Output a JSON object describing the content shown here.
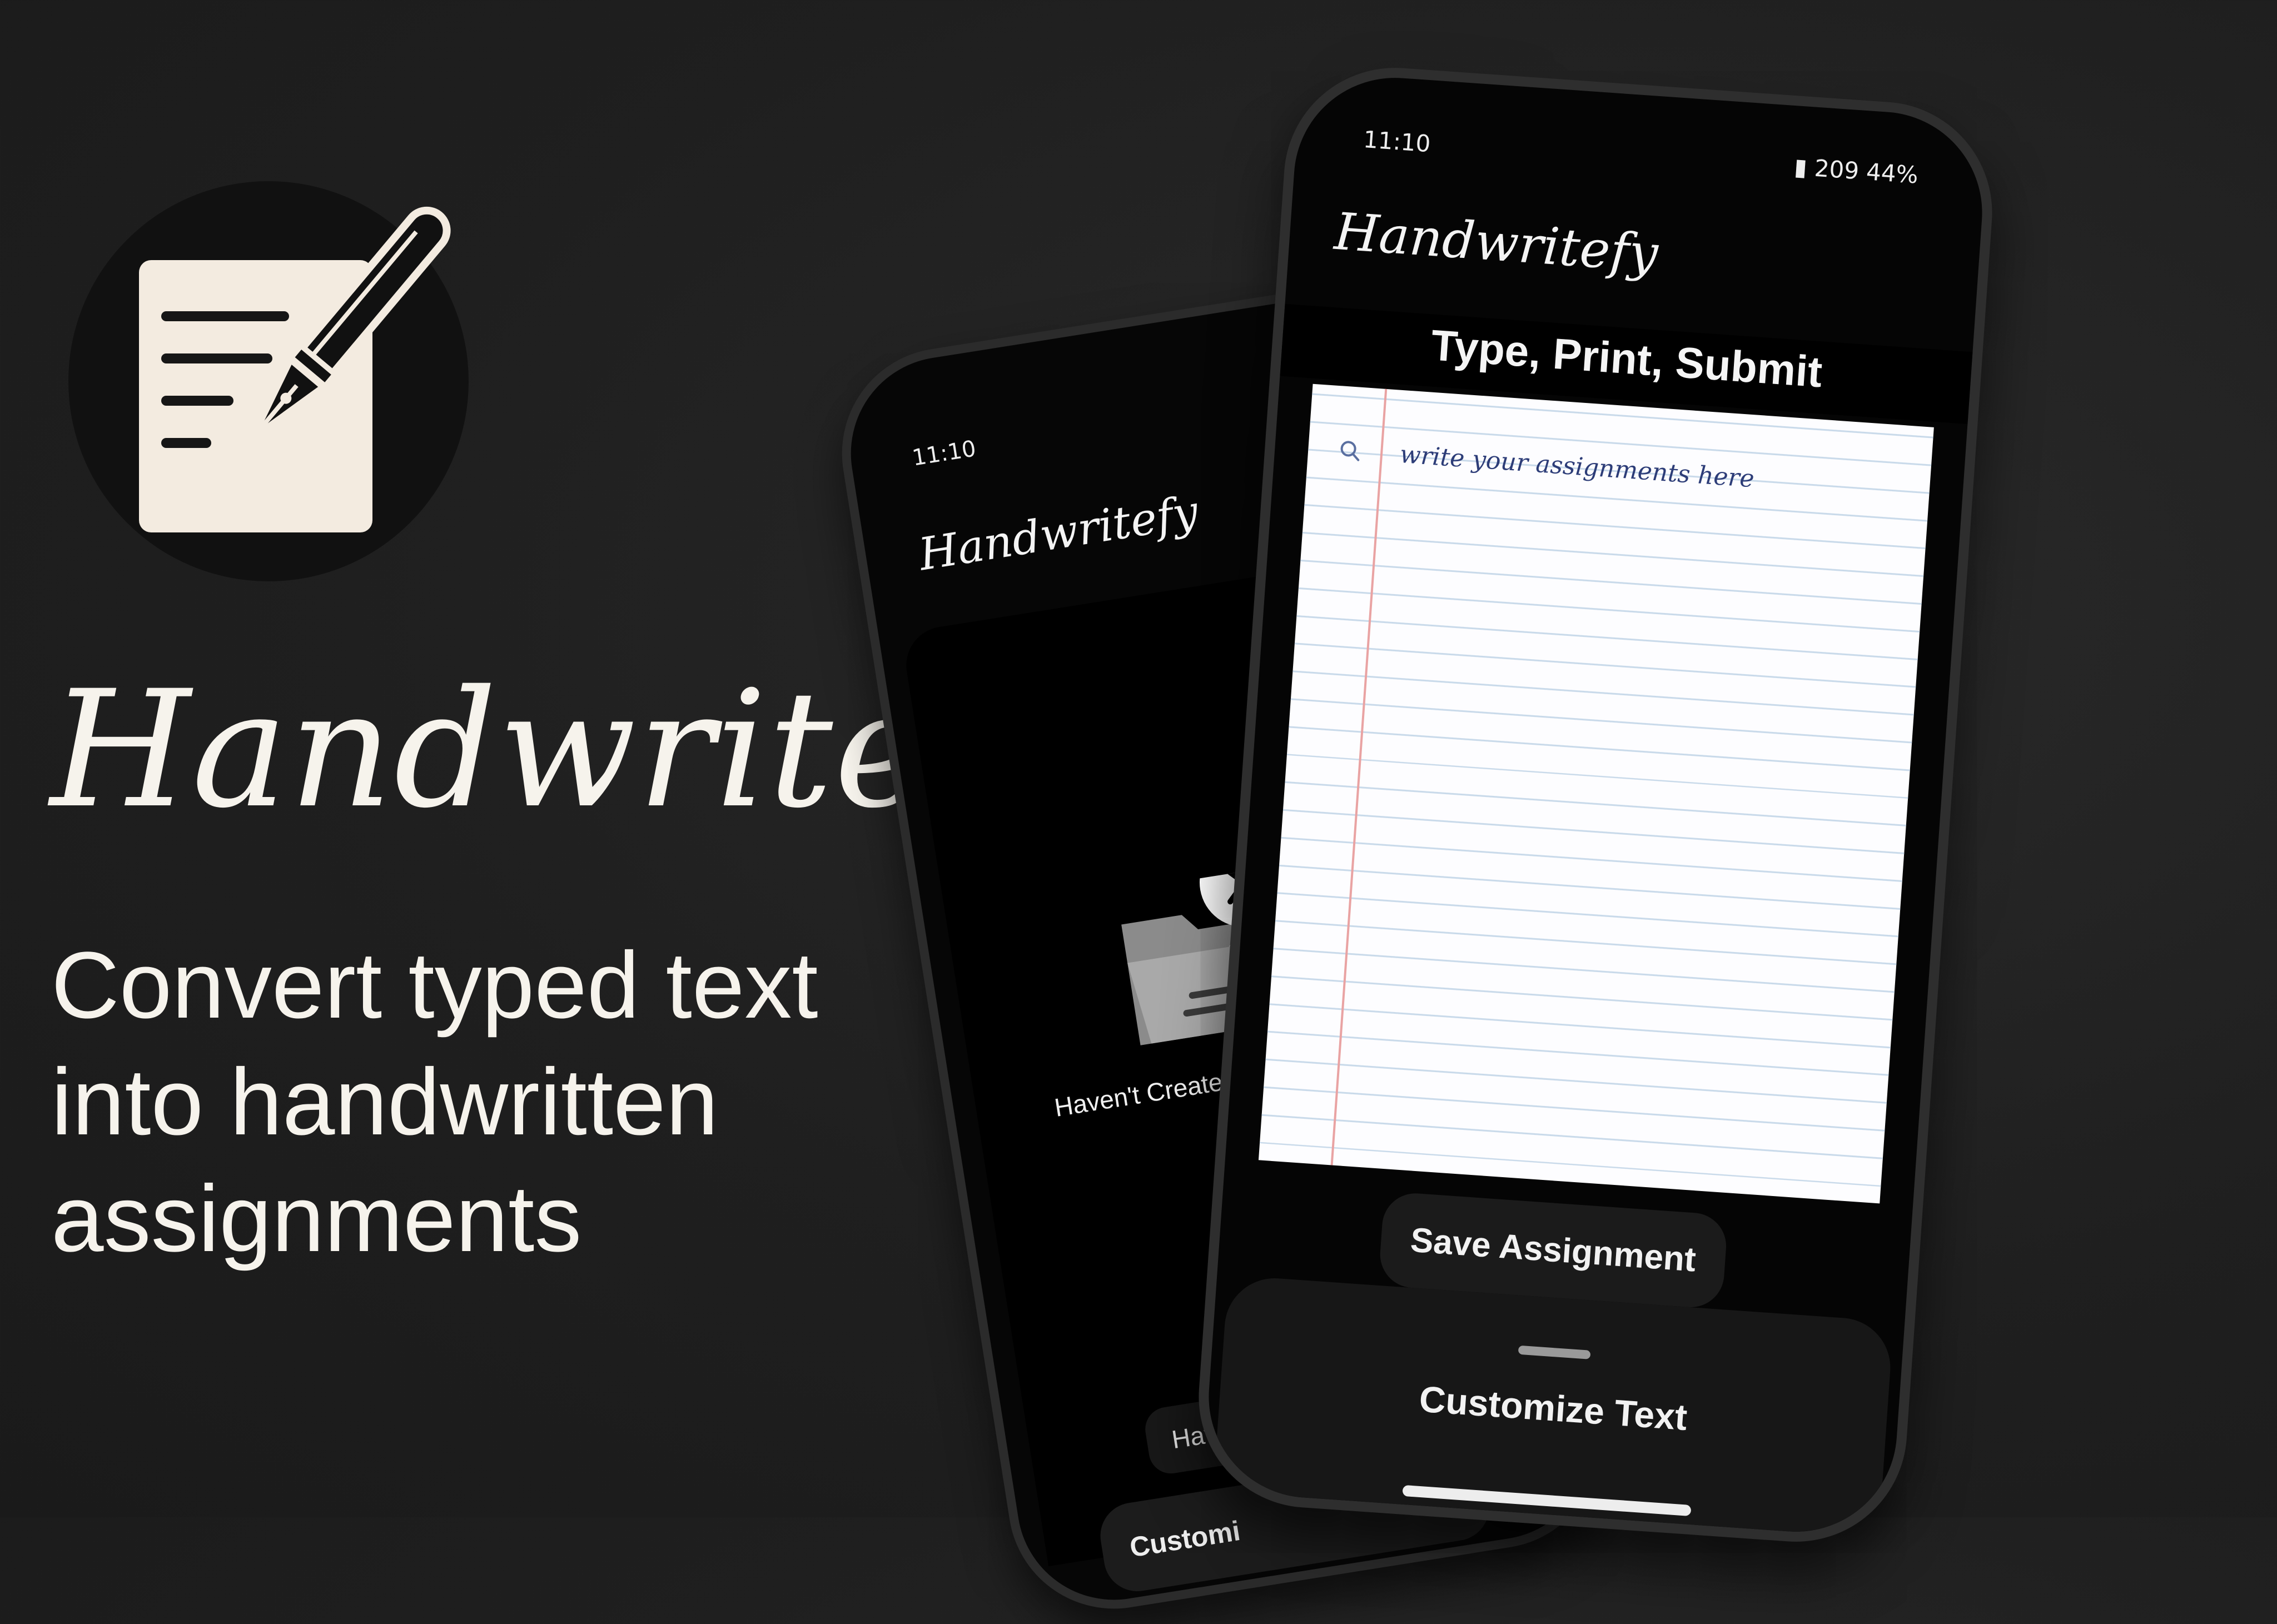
{
  "brand": {
    "app_name": "Handwritefy",
    "tagline": "Convert typed text into handwritten assignments"
  },
  "back_phone": {
    "status_time": "11:10",
    "app_title": "Handwritefy",
    "empty_state_label": "Haven't Created A",
    "button_partial_1": "Have",
    "button_partial_2": "Customi"
  },
  "front_phone": {
    "status_time": "11:10",
    "status_right": "209 44%",
    "app_title": "Handwritefy",
    "header": "Type, Print, Submit",
    "editor_placeholder": "write your assignments here",
    "save_button": "Save Assignment",
    "customize_button": "Customize Text"
  },
  "colors": {
    "background": "#1f1f1f",
    "paper": "#fdfdff",
    "ruled_line": "#c9daea",
    "margin_line": "#e9a3a3",
    "ink": "#2d3d78"
  },
  "icons": [
    "pen-icon",
    "document-icon",
    "wifi-icon",
    "signal-icon",
    "search-icon",
    "folder-icon",
    "close-icon"
  ]
}
